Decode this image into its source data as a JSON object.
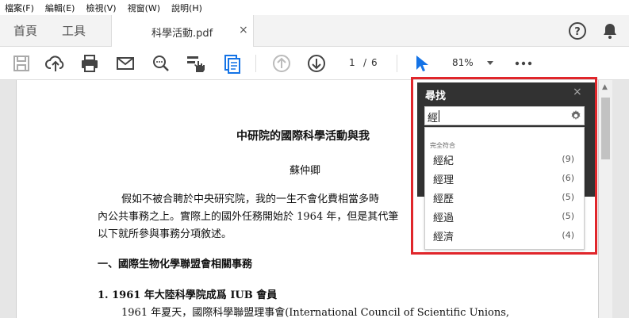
{
  "menu": [
    "檔案(F)",
    "編輯(E)",
    "檢視(V)",
    "視窗(W)",
    "說明(H)"
  ],
  "tabs": {
    "home": "首頁",
    "tools": "工具",
    "document": "科學活動.pdf",
    "close": "×"
  },
  "toolbar": {
    "page_current": "1",
    "page_sep": "/",
    "page_total": "6",
    "zoom": "81%"
  },
  "document": {
    "title": "中研院的國際科學活動與我",
    "author": "蘇仲卿",
    "para1_line1": "假如不被合聘於中央研究院，我的一生不會化費相當多時",
    "para1_line2": "內公共事務之上。實際上的國外任務開始於 1964 年，但是其代筆",
    "para1_line3": "以下就所參與事務分項敘述。",
    "section1": "一、國際生物化學聯盟會相關事務",
    "sub1": "1. 1961 年大陸科學院成爲 IUB 會員",
    "para2_line1": "1961 年夏天，國際科學聯盟理事會(International Council of Scientific Unions,"
  },
  "find": {
    "title": "尋找",
    "close": "×",
    "query": "經",
    "section_label": "完全符合",
    "results": [
      {
        "label": "經紀",
        "count": "(9)"
      },
      {
        "label": "經理",
        "count": "(6)"
      },
      {
        "label": "經歷",
        "count": "(5)"
      },
      {
        "label": "經過",
        "count": "(5)"
      },
      {
        "label": "經濟",
        "count": "(4)"
      }
    ]
  },
  "colors": {
    "highlight_frame": "#e0262b",
    "accent": "#1473e6",
    "panel_bg": "#323232"
  }
}
